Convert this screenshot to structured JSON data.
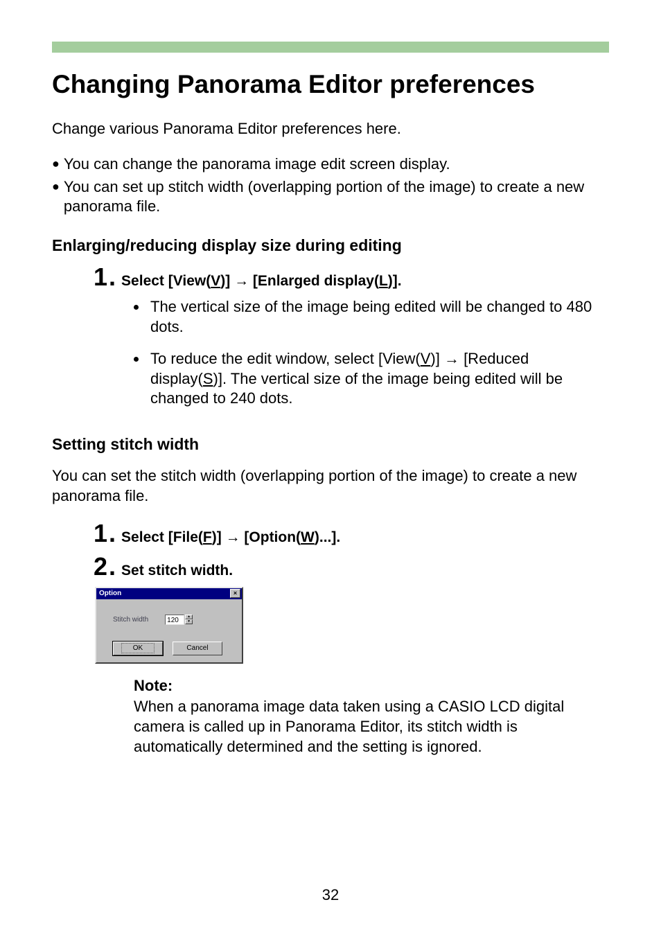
{
  "title": "Changing Panorama Editor preferences",
  "intro": "Change various Panorama Editor preferences here.",
  "bullets": [
    "You can change the panorama image edit screen display.",
    "You can set up stitch width (overlapping portion of the image) to create a new panorama file."
  ],
  "section1": {
    "heading": "Enlarging/reducing display size during editing",
    "step1_num": "1",
    "step1_pre": "Select [View(",
    "step1_u1": "V",
    "step1_mid": ")] ",
    "step1_arrow": "→",
    "step1_mid2": " [Enlarged display(",
    "step1_u2": "L",
    "step1_end": ")].",
    "sub_a": "The vertical size of the image being edited will be changed to 480 dots.",
    "sub_b_pre": "To reduce the edit window, select [View(",
    "sub_b_u1": "V",
    "sub_b_mid": ")] ",
    "sub_b_arrow": "→",
    "sub_b_mid2": " [Reduced display(",
    "sub_b_u2": "S",
    "sub_b_end": ")]. The vertical size of the image being edited will be changed to 240 dots."
  },
  "section2": {
    "heading": "Setting stitch width",
    "para": "You can set the stitch width (overlapping portion of the image) to create a new panorama file.",
    "step1_num": "1",
    "step1_pre": "Select [File(",
    "step1_u1": "F",
    "step1_mid": ")] ",
    "step1_arrow": "→",
    "step1_mid2": " [Option(",
    "step1_u2": "W",
    "step1_end": ")...].",
    "step2_num": "2",
    "step2_text": "Set stitch width."
  },
  "dialog": {
    "title": "Option",
    "close": "×",
    "field_label": "Stitch width",
    "field_value": "120",
    "spin_up": "▲",
    "spin_down": "▼",
    "ok": "OK",
    "cancel": "Cancel"
  },
  "note": {
    "label": "Note:",
    "body": "When a panorama image data taken using a CASIO LCD digital camera is called up in Panorama Editor, its stitch width is automatically determined and the setting is ignored."
  },
  "page_number": "32"
}
